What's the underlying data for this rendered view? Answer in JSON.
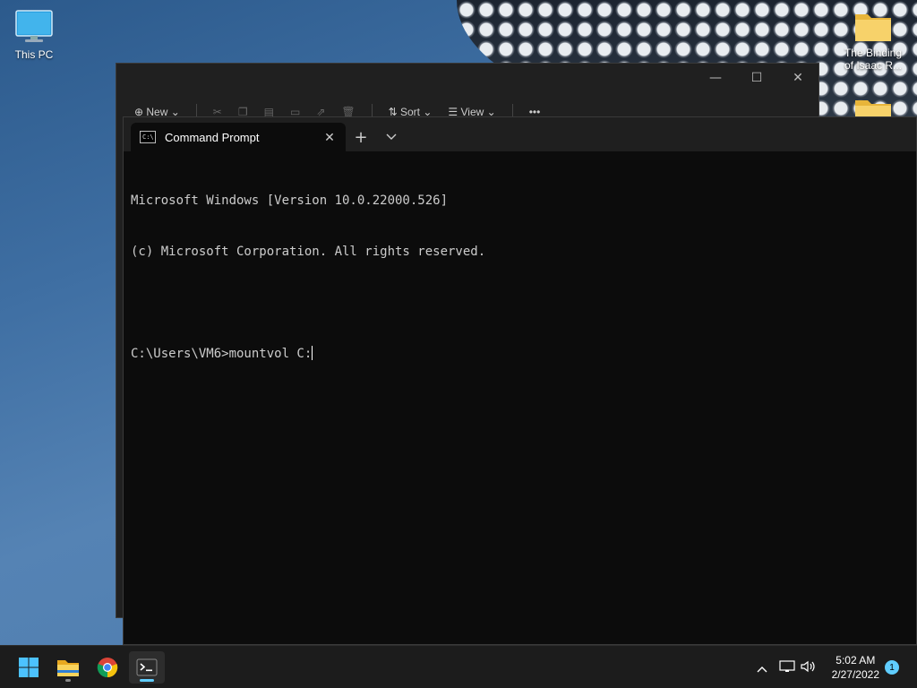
{
  "desktop": {
    "icons": [
      {
        "label": "This PC",
        "icon": "monitor-icon"
      },
      {
        "label": "The Binding of Isaac R...",
        "icon": "folder-icon"
      },
      {
        "label": "",
        "icon": "folder-icon"
      }
    ]
  },
  "explorer": {
    "toolbar": {
      "new_label": "New",
      "sort_label": "Sort",
      "view_label": "View",
      "more_label": "•••"
    }
  },
  "terminal": {
    "tab_title": "Command Prompt",
    "tab_icon_text": "C:\\",
    "new_tab_symbol": "+",
    "dropdown_symbol": "⌄",
    "lines": [
      "Microsoft Windows [Version 10.0.22000.526]",
      "(c) Microsoft Corporation. All rights reserved.",
      "",
      "C:\\Users\\VM6>mountvol C:"
    ]
  },
  "taskbar": {
    "apps": [
      {
        "name": "Start",
        "icon": "windows-start-icon"
      },
      {
        "name": "File Explorer",
        "icon": "file-explorer-icon"
      },
      {
        "name": "Google Chrome",
        "icon": "chrome-icon"
      },
      {
        "name": "Terminal",
        "icon": "terminal-icon"
      }
    ],
    "time": "5:02 AM",
    "date": "2/27/2022",
    "notification_count": "1"
  },
  "colors": {
    "terminal_bg": "#0c0c0c",
    "terminal_text": "#cccccc",
    "accent": "#60cdff",
    "taskbar_bg": "#1c1c1c"
  }
}
